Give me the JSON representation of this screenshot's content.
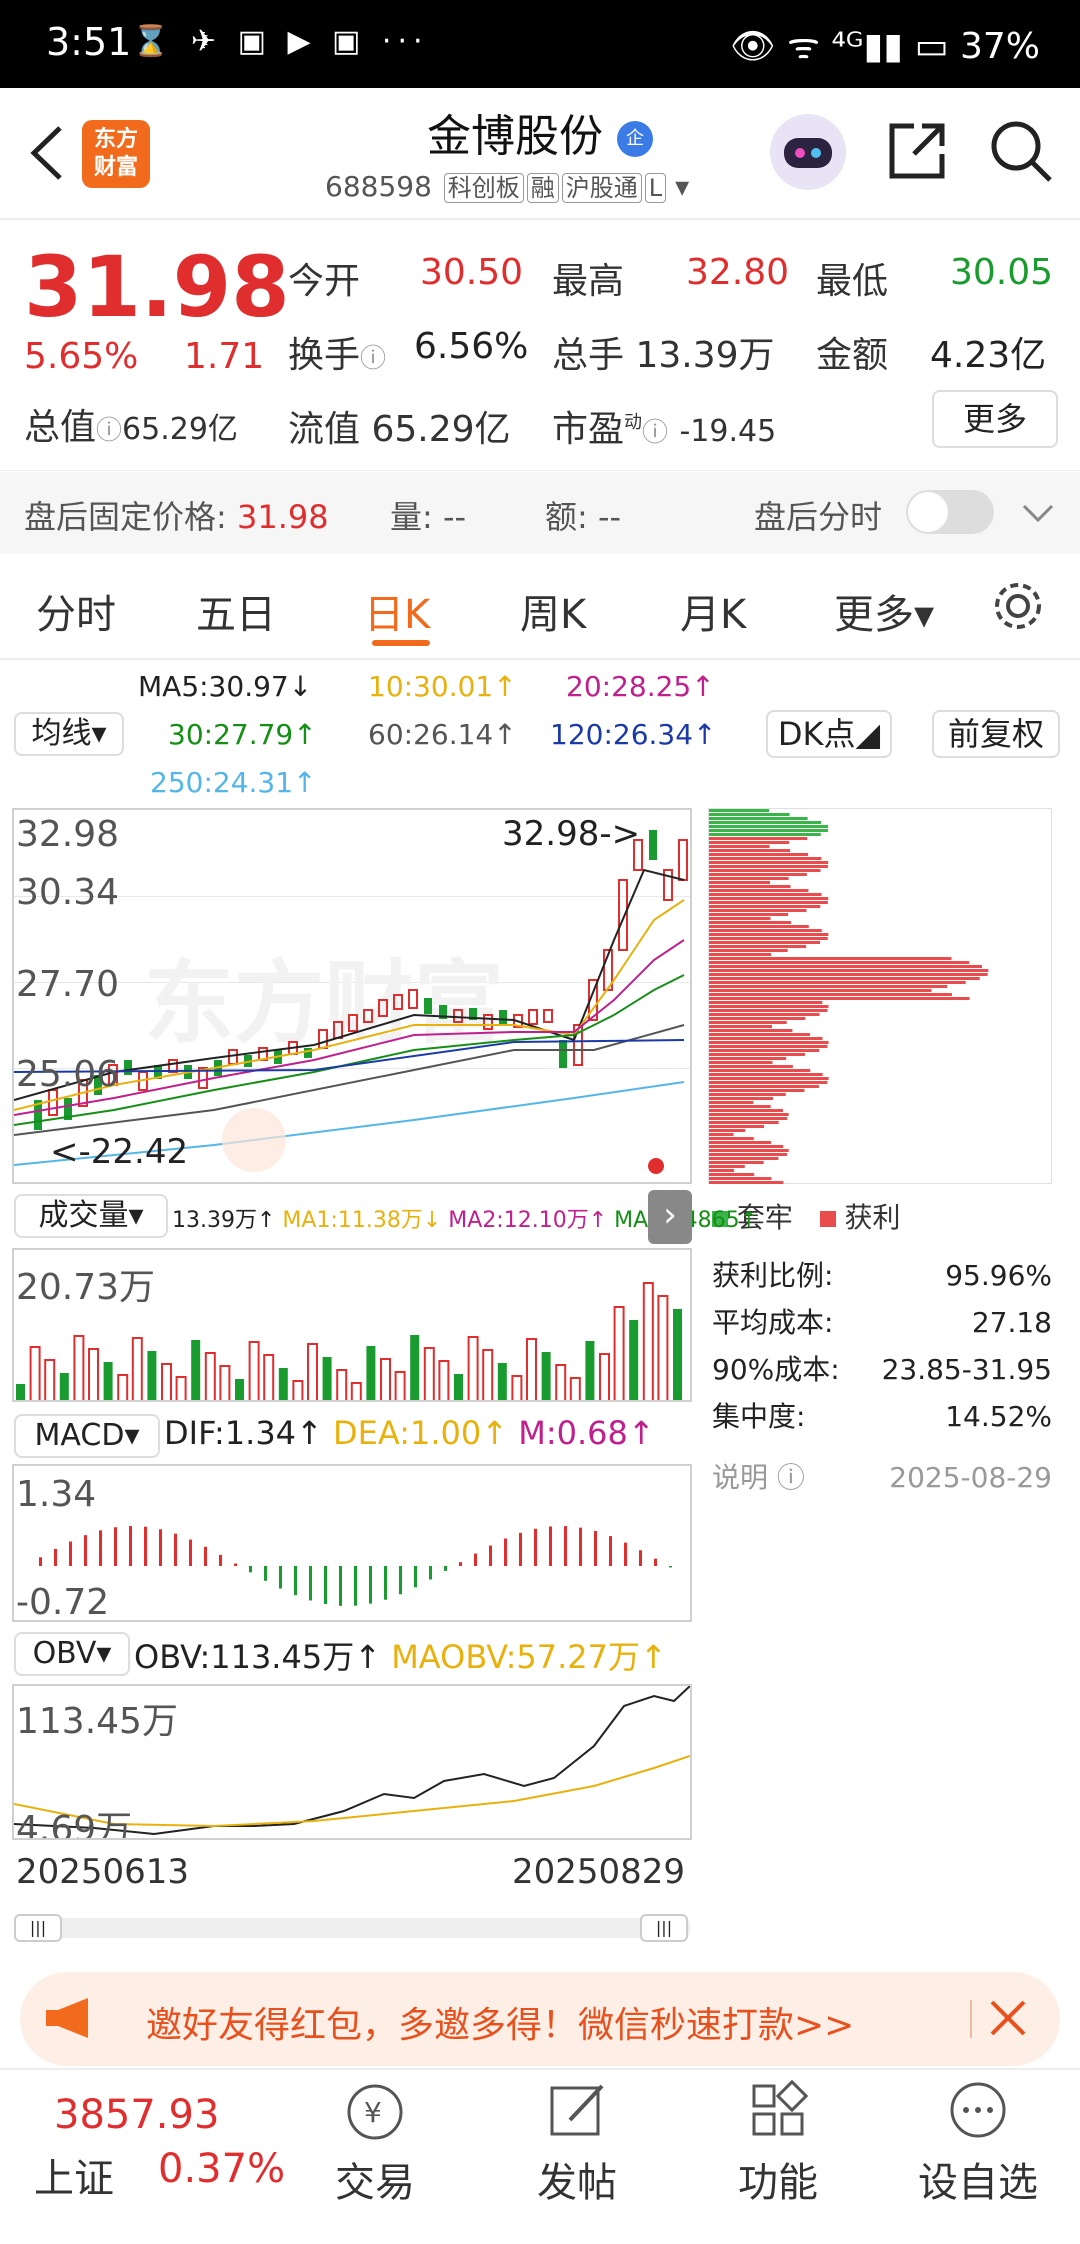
{
  "status": {
    "time": "3:51",
    "icons": "⌛ ✈ ▣ ▶ ▣ ···",
    "right": "👁 ᯤ ⁴ᴳ▮▮ ▭ 37%"
  },
  "header": {
    "logo": "东方\n财富",
    "title": "金博股份",
    "title_badge": "企",
    "code": "688598",
    "tags": [
      "科创板",
      "融",
      "沪股通",
      "L"
    ]
  },
  "quote": {
    "price": "31.98",
    "pct": "5.65%",
    "change": "1.71",
    "rows": [
      [
        {
          "l": "今开",
          "v": "30.50",
          "c": "red"
        },
        {
          "l": "最高",
          "v": "32.80",
          "c": "red"
        },
        {
          "l": "最低",
          "v": "30.05",
          "c": "green"
        }
      ],
      [
        {
          "l": "换手",
          "v": "6.56%",
          "c": "dark"
        },
        {
          "l": "总手",
          "v": "13.39万",
          "c": "dark"
        },
        {
          "l": "金额",
          "v": "4.23亿",
          "c": "dark"
        }
      ]
    ],
    "total_value_label": "总值",
    "total_value": "65.29亿",
    "float_label": "流值",
    "float_value": "65.29亿",
    "pe_label": "市盈",
    "pe_sup": "动",
    "pe_value": "-19.45",
    "more": "更多"
  },
  "afterhours": {
    "label": "盘后固定价格:",
    "price": "31.98",
    "vol_label": "量:",
    "vol": "--",
    "amt_label": "额:",
    "amt": "--",
    "toggle_label": "盘后分时"
  },
  "tabs": [
    "分时",
    "五日",
    "日K",
    "周K",
    "月K",
    "更多▾"
  ],
  "ma": {
    "dropdown": "均线",
    "ma5": "MA5:30.97↓",
    "ma10": "10:30.01↑",
    "ma20": "20:28.25↑",
    "ma30": "30:27.79↑",
    "ma60": "60:26.14↑",
    "ma120": "120:26.34↑",
    "ma250": "250:24.31↑",
    "dk": "DK点",
    "fq": "前复权"
  },
  "kline": {
    "y_labels": [
      "32.98",
      "30.34",
      "27.70",
      "25.06",
      "22.42"
    ],
    "high_marker": "32.98->",
    "low_marker": "<-22.42",
    "watermark": "东方财富"
  },
  "volume": {
    "dropdown": "成交量",
    "vals": "13.39万↑",
    "ma1": "MA1:11.38万↓",
    "ma2": "MA2:12.10万↑",
    "ma3": "MA3:84865↑",
    "ylabel": "20.73万"
  },
  "macd": {
    "dropdown": "MACD",
    "dif": "DIF:1.34↑",
    "dea": "DEA:1.00↑",
    "m": "M:0.68↑",
    "top": "1.34",
    "bottom": "-0.72"
  },
  "obv": {
    "dropdown": "OBV",
    "obv": "OBV:113.45万↑",
    "maobv": "MAOBV:57.27万↑",
    "top": "113.45万",
    "bottom": "4.69万"
  },
  "dates": {
    "start": "20250613",
    "end": "20250829"
  },
  "chips": {
    "legend1": "套牢",
    "legend2": "获利",
    "rows": [
      [
        "获利比例:",
        "95.96%"
      ],
      [
        "平均成本:",
        "27.18"
      ],
      [
        "90%成本:",
        "23.85-31.95"
      ],
      [
        "集中度:",
        "14.52%"
      ]
    ],
    "explain": "说明",
    "date": "2025-08-29"
  },
  "banner": {
    "text": "邀好友得红包，多邀多得！微信秒速打款>>"
  },
  "nav": {
    "index_value": "3857.93",
    "index_name": "上证",
    "index_pct": "0.37%",
    "items": [
      "交易",
      "发帖",
      "功能",
      "设自选"
    ]
  }
}
